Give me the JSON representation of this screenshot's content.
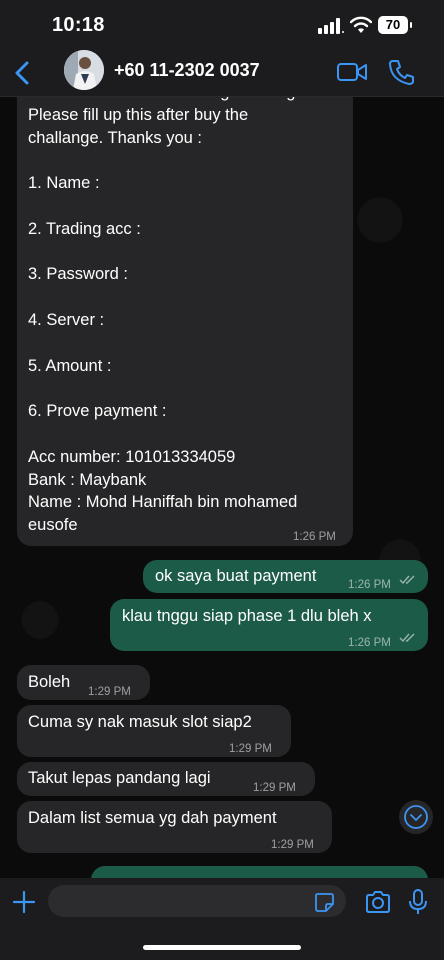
{
  "status_bar": {
    "time": "10:18",
    "battery": "70"
  },
  "header": {
    "contact_name": "+60 11-2302 0037"
  },
  "messages": [
    {
      "direction": "in",
      "text": "Hi all. Welcome for Passing challenge.\nPlease fill up this after buy the\nchallange. Thanks you :\n\n1. Name :\n\n2. Trading acc :\n\n3. Password :\n\n4. Server :\n\n5. Amount :\n\n6. Prove payment :\n\nAcc number: 101013334059\nBank : Maybank\nName : Mohd Haniffah bin mohamed\neusofe",
      "time": "1:26 PM"
    },
    {
      "direction": "out",
      "text": "ok saya buat payment",
      "time": "1:26 PM"
    },
    {
      "direction": "out",
      "text": "klau tnggu siap phase 1 dlu bleh x",
      "time": "1:26 PM"
    },
    {
      "direction": "in",
      "text": "Boleh",
      "time": "1:29 PM"
    },
    {
      "direction": "in",
      "text": "Cuma sy nak masuk slot siap2",
      "time": "1:29 PM"
    },
    {
      "direction": "in",
      "text": "Takut lepas pandang lagi",
      "time": "1:29 PM"
    },
    {
      "direction": "in",
      "text": "Dalam list semua yg dah payment",
      "time": "1:29 PM"
    },
    {
      "direction": "out",
      "text": "",
      "time": ""
    }
  ],
  "composer": {
    "value": ""
  }
}
